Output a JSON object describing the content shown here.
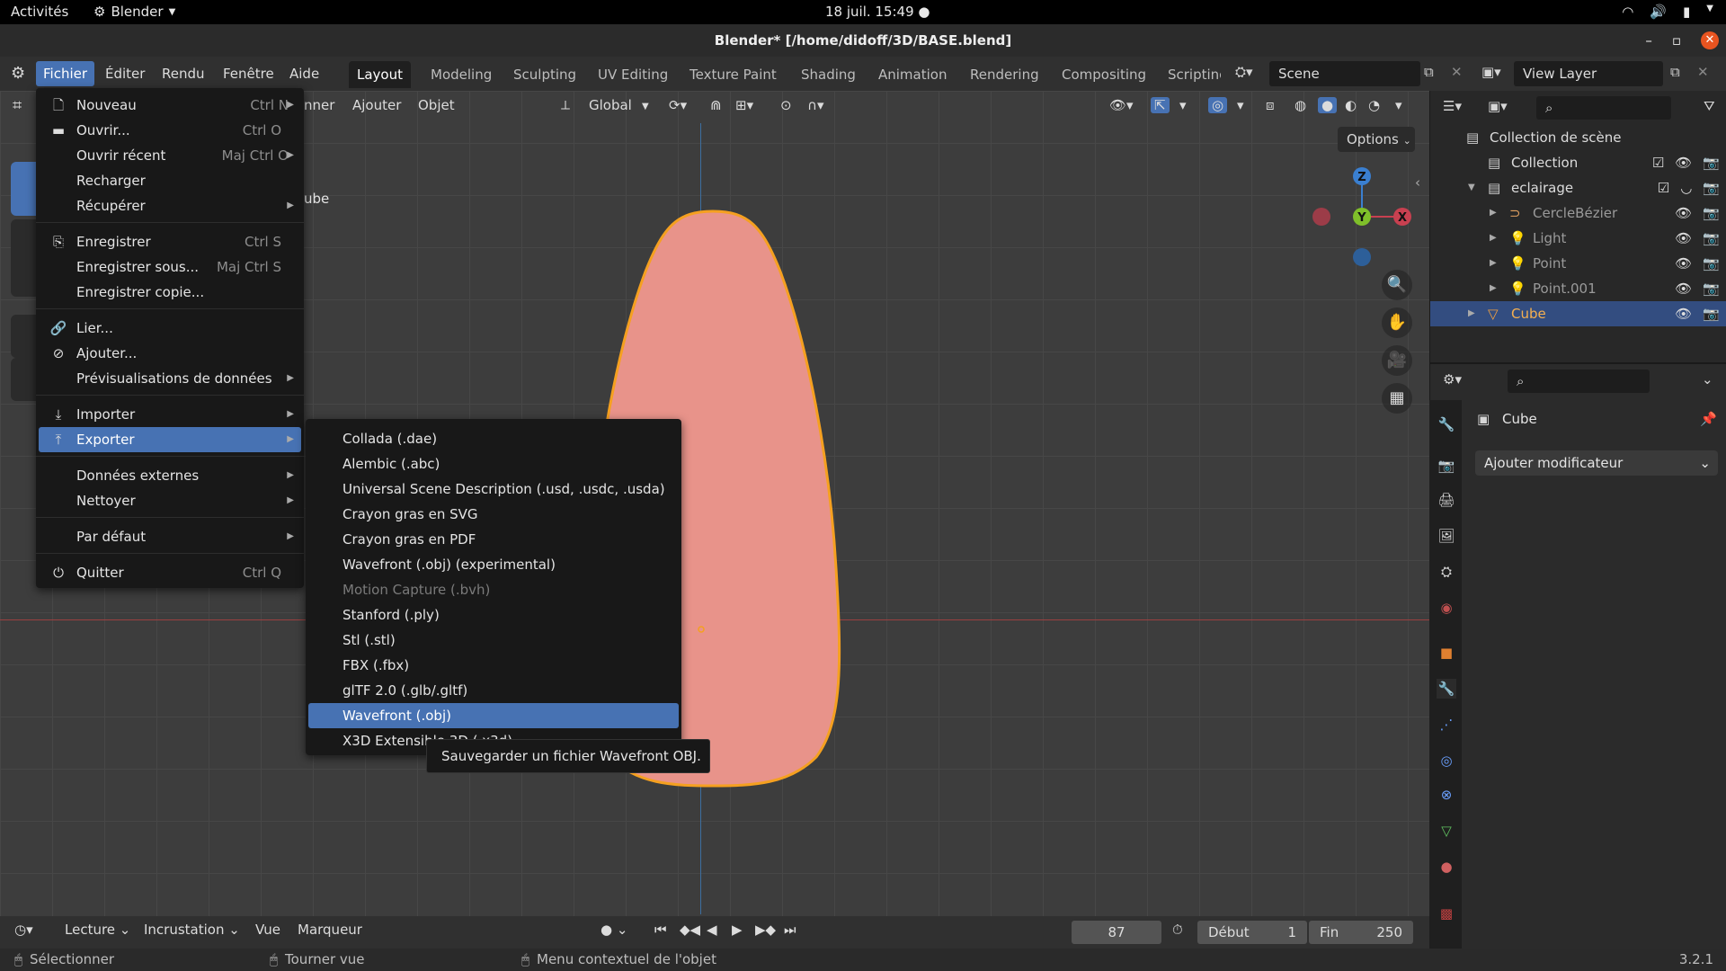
{
  "gnome": {
    "activities": "Activités",
    "app_name": "Blender",
    "clock": "18 juil.  15:49"
  },
  "window": {
    "title": "Blender* [/home/didoff/3D/BASE.blend]"
  },
  "menubar": {
    "items": [
      "Fichier",
      "Éditer",
      "Rendu",
      "Fenêtre",
      "Aide"
    ],
    "workspaces": [
      "Layout",
      "Modeling",
      "Sculpting",
      "UV Editing",
      "Texture Paint",
      "Shading",
      "Animation",
      "Rendering",
      "Compositing",
      "Scriptinç"
    ],
    "scene": "Scene",
    "view_layer": "View Layer"
  },
  "viewport_header": {
    "partial_menu": "nner",
    "add": "Ajouter",
    "object": "Objet",
    "transform": "Global",
    "options": "Options",
    "active_object_partial": "ube"
  },
  "gizmo": {
    "z": "Z",
    "y": "Y",
    "x": "X"
  },
  "file_menu": {
    "items": [
      {
        "label": "Nouveau",
        "shortcut": "Ctrl N",
        "arrow": true,
        "icon": "new-file-icon",
        "glyph": "🗋"
      },
      {
        "label": "Ouvrir...",
        "shortcut": "Ctrl O",
        "icon": "folder-icon",
        "glyph": "▬"
      },
      {
        "label": "Ouvrir récent",
        "shortcut": "Maj Ctrl O",
        "arrow": true
      },
      {
        "label": "Recharger"
      },
      {
        "label": "Récupérer",
        "arrow": true
      },
      {
        "label": "Enregistrer",
        "shortcut": "Ctrl S",
        "icon": "save-icon",
        "glyph": "⎘"
      },
      {
        "label": "Enregistrer sous...",
        "shortcut": "Maj Ctrl S"
      },
      {
        "label": "Enregistrer copie..."
      },
      {
        "label": "Lier...",
        "icon": "link-icon",
        "glyph": "🔗"
      },
      {
        "label": "Ajouter...",
        "icon": "append-icon",
        "glyph": "⊘"
      },
      {
        "label": "Prévisualisations de données",
        "arrow": true
      },
      {
        "label": "Importer",
        "arrow": true,
        "icon": "import-icon",
        "glyph": "⤓"
      },
      {
        "label": "Exporter",
        "arrow": true,
        "icon": "export-icon",
        "glyph": "⤒",
        "highlight": true
      },
      {
        "label": "Données externes",
        "arrow": true
      },
      {
        "label": "Nettoyer",
        "arrow": true
      },
      {
        "label": "Par défaut",
        "arrow": true
      },
      {
        "label": "Quitter",
        "shortcut": "Ctrl Q",
        "icon": "power-icon",
        "glyph": "⏻"
      }
    ]
  },
  "export_menu": {
    "items": [
      {
        "label": "Collada (.dae)"
      },
      {
        "label": "Alembic (.abc)"
      },
      {
        "label": "Universal Scene Description (.usd, .usdc, .usda)"
      },
      {
        "label": "Crayon gras en SVG"
      },
      {
        "label": "Crayon gras en PDF"
      },
      {
        "label": "Wavefront (.obj) (experimental)"
      },
      {
        "label": "Motion Capture (.bvh)",
        "disabled": true
      },
      {
        "label": "Stanford (.ply)"
      },
      {
        "label": "Stl (.stl)"
      },
      {
        "label": "FBX (.fbx)"
      },
      {
        "label": "glTF 2.0 (.glb/.gltf)"
      },
      {
        "label": "Wavefront (.obj)",
        "highlight": true
      },
      {
        "label": "X3D Extensible 3D (.x3d)"
      }
    ]
  },
  "tooltip": "Sauvegarder un fichier Wavefront OBJ.",
  "outliner": {
    "rows": [
      {
        "label": "Collection de scène",
        "indent": 0
      },
      {
        "label": "Collection",
        "indent": 1
      },
      {
        "label": "eclairage",
        "indent": 1
      },
      {
        "label": "CercleBézier",
        "indent": 2
      },
      {
        "label": "Light",
        "indent": 2
      },
      {
        "label": "Point",
        "indent": 2
      },
      {
        "label": "Point.001",
        "indent": 2
      },
      {
        "label": "Cube",
        "indent": 1,
        "selected": true
      }
    ]
  },
  "properties": {
    "object_name": "Cube",
    "add_modifier": "Ajouter modificateur"
  },
  "timeline": {
    "playback": "Lecture",
    "keying": "Incrustation",
    "view": "Vue",
    "marker": "Marqueur",
    "current_frame": "87",
    "start_label": "Début",
    "start": "1",
    "end_label": "Fin",
    "end": "250"
  },
  "statusbar": {
    "select": "Sélectionner",
    "rotate": "Tourner vue",
    "context": "Menu contextuel de l'objet",
    "version": "3.2.1"
  },
  "colors": {
    "accent": "#4772b3",
    "mesh_fill": "#e8938a",
    "mesh_outline": "#f5a020"
  }
}
